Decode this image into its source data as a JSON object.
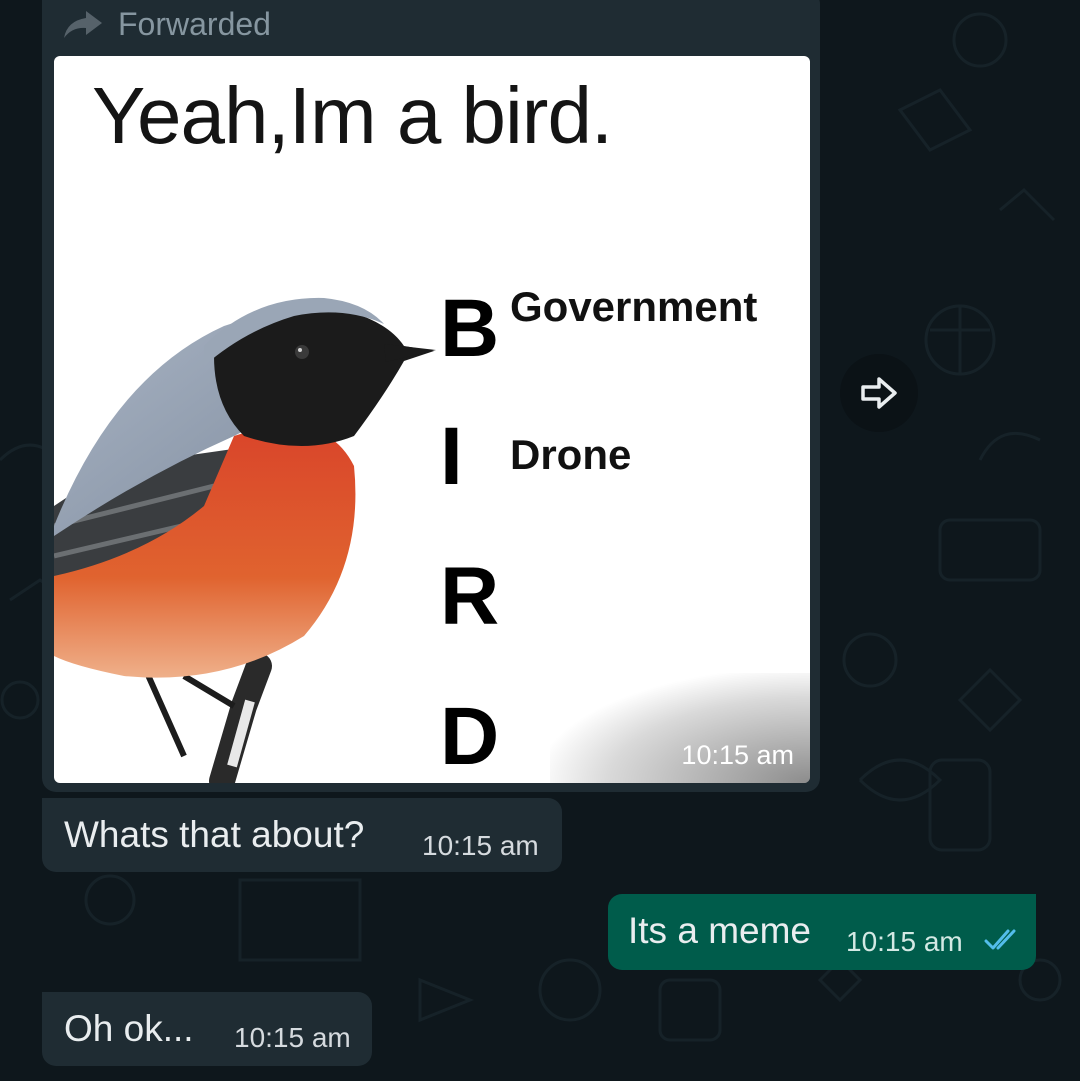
{
  "forwarded_label": "Forwarded",
  "meme": {
    "title": "Yeah,Im a bird.",
    "letters": [
      "B",
      "I",
      "R",
      "D"
    ],
    "words": [
      "Government",
      "Drone"
    ],
    "time": "10:15 am"
  },
  "messages": [
    {
      "direction": "incoming",
      "text": "Whats that about?",
      "time": "10:15 am"
    },
    {
      "direction": "outgoing",
      "text": "Its a meme",
      "time": "10:15 am",
      "status": "read",
      "status_icon": "double-check-icon"
    },
    {
      "direction": "incoming",
      "text": "Oh ok...",
      "time": "10:15 am"
    }
  ],
  "icons": {
    "forward": "forward-arrow-icon",
    "share": "share-arrow-icon"
  },
  "colors": {
    "background": "#0b141a",
    "incoming_bubble": "#1f2c33",
    "outgoing_bubble": "#005c4b",
    "read_ticks": "#53bdeb"
  }
}
